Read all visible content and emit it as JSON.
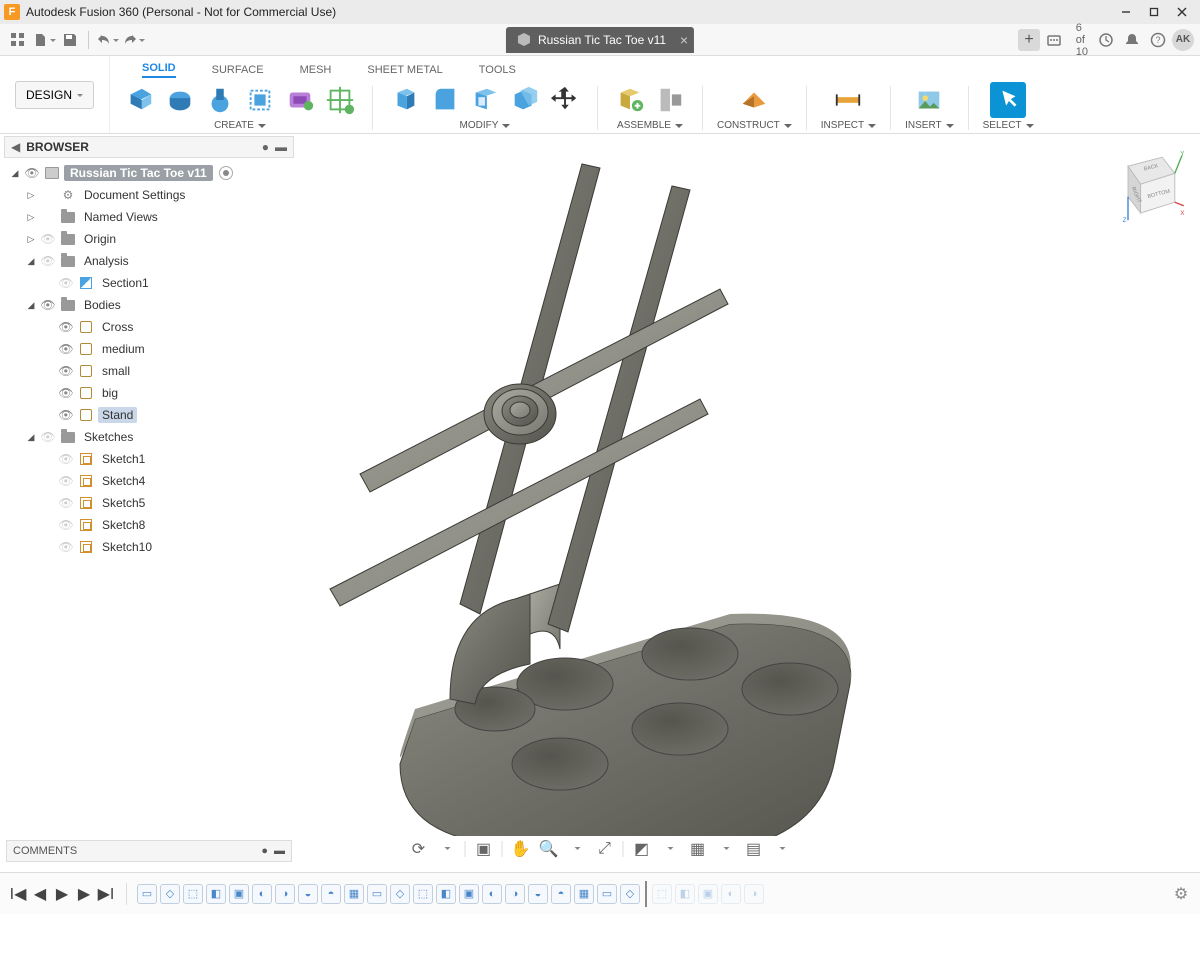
{
  "titlebar": {
    "app_letter": "F",
    "title": "Autodesk Fusion 360 (Personal - Not for Commercial Use)"
  },
  "qat": {
    "doc_title": "Russian Tic Tac Toe v11",
    "save_count": "6 of 10",
    "avatar": "AK"
  },
  "workspace": {
    "label": "DESIGN"
  },
  "ribbon_tabs": [
    "SOLID",
    "SURFACE",
    "MESH",
    "SHEET METAL",
    "TOOLS"
  ],
  "ribbon_groups": {
    "create": "CREATE",
    "modify": "MODIFY",
    "assemble": "ASSEMBLE",
    "construct": "CONSTRUCT",
    "inspect": "INSPECT",
    "insert": "INSERT",
    "select": "SELECT"
  },
  "browser": {
    "title": "BROWSER",
    "root": "Russian Tic Tac Toe v11",
    "items": {
      "doc_settings": "Document Settings",
      "named_views": "Named Views",
      "origin": "Origin",
      "analysis": "Analysis",
      "section1": "Section1",
      "bodies": "Bodies",
      "body_cross": "Cross",
      "body_medium": "medium",
      "body_small": "small",
      "body_big": "big",
      "body_stand": "Stand",
      "sketches": "Sketches",
      "sketch1": "Sketch1",
      "sketch4": "Sketch4",
      "sketch5": "Sketch5",
      "sketch8": "Sketch8",
      "sketch10": "Sketch10"
    }
  },
  "viewcube": {
    "right": "RIGHT",
    "back": "BACK",
    "bottom": "BOTTOM",
    "x": "X",
    "y": "Y",
    "z": "Z"
  },
  "comments": {
    "title": "COMMENTS"
  },
  "timeline": {
    "count": 27,
    "marker_after": 22
  }
}
